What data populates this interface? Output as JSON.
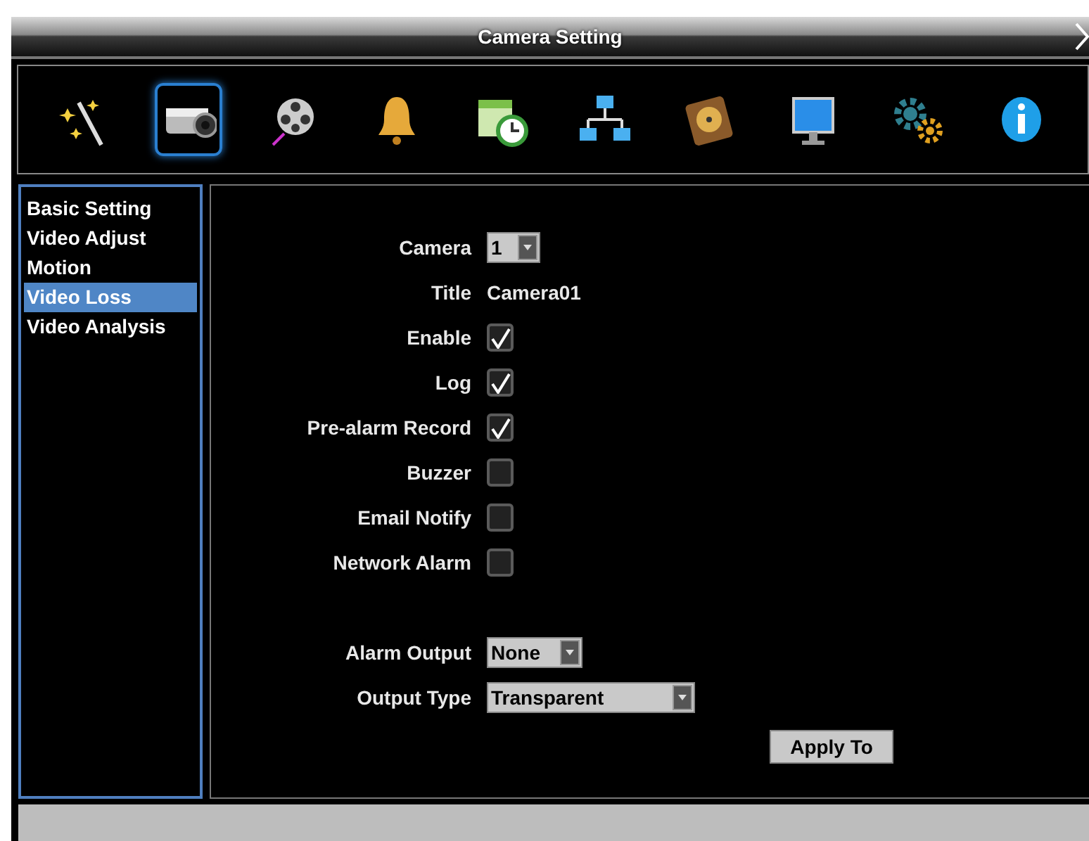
{
  "window": {
    "title": "Camera Setting"
  },
  "toolbar": [
    {
      "selected": false
    },
    {
      "selected": true
    },
    {
      "selected": false
    },
    {
      "selected": false
    },
    {
      "selected": false
    },
    {
      "selected": false
    },
    {
      "selected": false
    },
    {
      "selected": false
    },
    {
      "selected": false
    },
    {
      "selected": false
    }
  ],
  "sidebar": {
    "items": [
      {
        "label": "Basic Setting",
        "selected": false
      },
      {
        "label": "Video Adjust",
        "selected": false
      },
      {
        "label": "Motion",
        "selected": false
      },
      {
        "label": "Video Loss",
        "selected": true
      },
      {
        "label": "Video Analysis",
        "selected": false
      }
    ]
  },
  "form": {
    "fields": [
      {
        "kind": "select",
        "label": "Camera",
        "value": "1"
      },
      {
        "kind": "text",
        "label": "Title",
        "value": "Camera01"
      },
      {
        "kind": "checkbox",
        "label": "Enable",
        "checked": true
      },
      {
        "kind": "checkbox",
        "label": "Log",
        "checked": true
      },
      {
        "kind": "checkbox",
        "label": "Pre-alarm Record",
        "checked": true
      },
      {
        "kind": "checkbox",
        "label": "Buzzer",
        "checked": false
      },
      {
        "kind": "checkbox",
        "label": "Email Notify",
        "checked": false
      },
      {
        "kind": "checkbox",
        "label": "Network Alarm",
        "checked": false
      },
      {
        "kind": "spacer"
      },
      {
        "kind": "select",
        "label": "Alarm Output",
        "value": "None"
      },
      {
        "kind": "select",
        "label": "Output Type",
        "value": "Transparent"
      }
    ],
    "apply_button": "Apply To"
  }
}
